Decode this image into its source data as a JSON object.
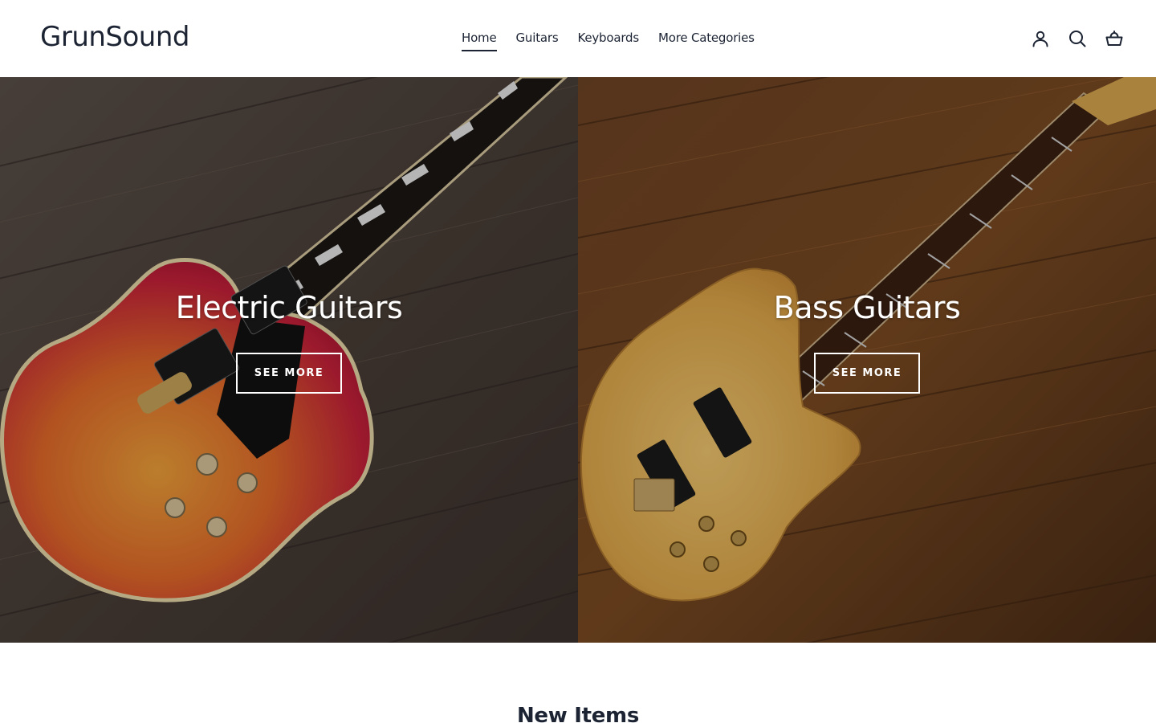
{
  "header": {
    "logo": "GrunSound",
    "nav": [
      {
        "label": "Home",
        "active": true
      },
      {
        "label": "Guitars",
        "active": false
      },
      {
        "label": "Keyboards",
        "active": false
      },
      {
        "label": "More Categories",
        "active": false
      }
    ],
    "icons": [
      "account-icon",
      "search-icon",
      "cart-icon"
    ]
  },
  "hero": {
    "panels": [
      {
        "title": "Electric Guitars",
        "button": "SEE MORE"
      },
      {
        "title": "Bass Guitars",
        "button": "SEE MORE"
      }
    ]
  },
  "section": {
    "title": "New Items"
  },
  "colors": {
    "text": "#1c2434",
    "background": "#ffffff",
    "button_border": "#ffffff"
  }
}
